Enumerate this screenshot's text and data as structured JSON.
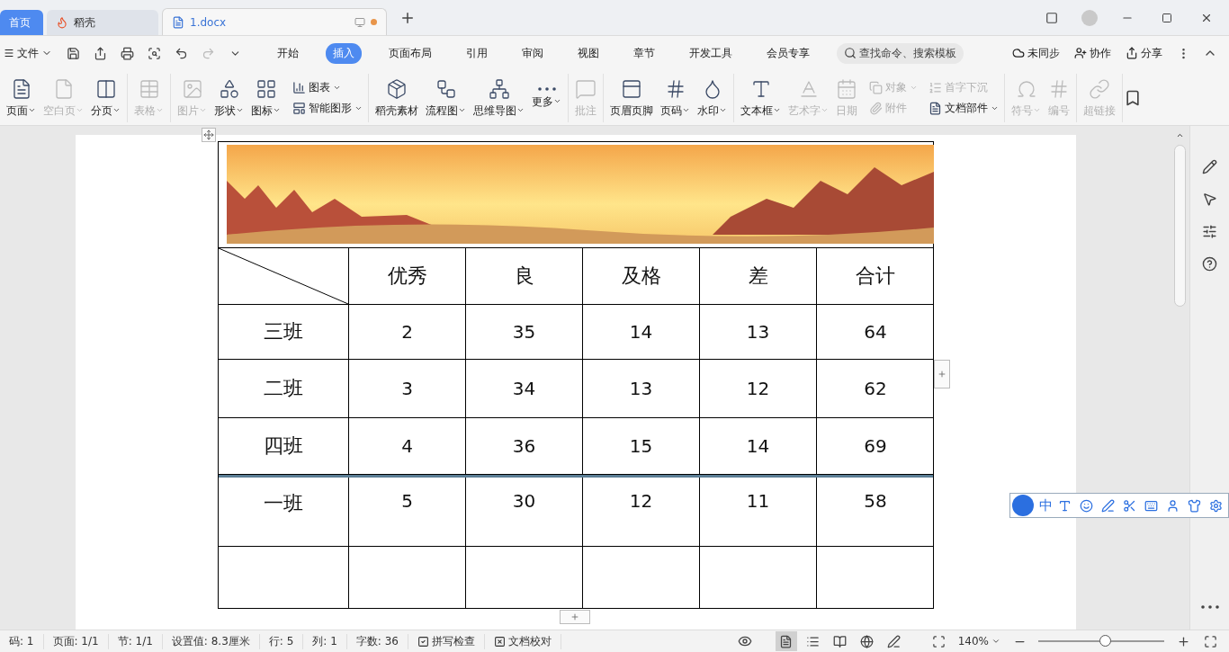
{
  "tabs": [
    {
      "label": "首页",
      "kind": "home",
      "selected": false
    },
    {
      "label": "稻壳",
      "kind": "app",
      "selected": false
    },
    {
      "label": "1.docx",
      "kind": "doc",
      "selected": true
    }
  ],
  "menu": {
    "file": "文件",
    "ribbon_tabs": [
      {
        "label": "开始",
        "selected": false
      },
      {
        "label": "插入",
        "selected": true
      },
      {
        "label": "页面布局",
        "selected": false
      },
      {
        "label": "引用",
        "selected": false
      },
      {
        "label": "审阅",
        "selected": false
      },
      {
        "label": "视图",
        "selected": false
      },
      {
        "label": "章节",
        "selected": false
      },
      {
        "label": "开发工具",
        "selected": false
      },
      {
        "label": "会员专享",
        "selected": false
      }
    ],
    "search": {
      "placeholder": "查找命令、搜索模板"
    },
    "actions": [
      "未同步",
      "协作",
      "分享"
    ]
  },
  "ribbon": [
    [
      {
        "kind": "large",
        "label": "页面",
        "dropdown": true,
        "disabled": false
      },
      {
        "kind": "large",
        "label": "空白页",
        "dropdown": true,
        "disabled": true
      },
      {
        "kind": "large",
        "label": "分页",
        "dropdown": true,
        "disabled": false
      }
    ],
    [
      {
        "kind": "large",
        "label": "表格",
        "dropdown": true,
        "disabled": true
      }
    ],
    [
      {
        "kind": "large",
        "label": "图片",
        "dropdown": true,
        "disabled": true
      },
      {
        "kind": "large",
        "label": "形状",
        "dropdown": true,
        "disabled": false
      },
      {
        "kind": "large",
        "label": "图标",
        "dropdown": true,
        "disabled": false
      },
      {
        "kind": "stack",
        "items": [
          {
            "label": "图表",
            "dropdown": true,
            "disabled": false
          },
          {
            "label": "智能图形",
            "dropdown": true,
            "disabled": false
          }
        ]
      }
    ],
    [
      {
        "kind": "large",
        "label": "稻壳素材",
        "dropdown": false,
        "disabled": false
      },
      {
        "kind": "large",
        "label": "流程图",
        "dropdown": true,
        "disabled": false
      },
      {
        "kind": "large",
        "label": "思维导图",
        "dropdown": true,
        "disabled": false
      },
      {
        "kind": "large",
        "label": "更多",
        "dropdown": true,
        "disabled": false
      }
    ],
    [
      {
        "kind": "large",
        "label": "批注",
        "dropdown": false,
        "disabled": true
      }
    ],
    [
      {
        "kind": "large",
        "label": "页眉页脚",
        "dropdown": false,
        "disabled": false
      },
      {
        "kind": "large",
        "label": "页码",
        "dropdown": true,
        "disabled": false
      },
      {
        "kind": "large",
        "label": "水印",
        "dropdown": true,
        "disabled": false
      }
    ],
    [
      {
        "kind": "large",
        "label": "文本框",
        "dropdown": true,
        "disabled": false
      },
      {
        "kind": "large",
        "label": "艺术字",
        "dropdown": true,
        "disabled": true
      },
      {
        "kind": "large",
        "label": "日期",
        "dropdown": false,
        "disabled": true
      },
      {
        "kind": "stack",
        "items": [
          {
            "label": "对象",
            "dropdown": true,
            "disabled": true
          },
          {
            "label": "附件",
            "dropdown": false,
            "disabled": true
          }
        ]
      },
      {
        "kind": "stack",
        "items": [
          {
            "label": "首字下沉",
            "dropdown": false,
            "disabled": true
          },
          {
            "label": "文档部件",
            "dropdown": true,
            "disabled": false
          }
        ]
      }
    ],
    [
      {
        "kind": "large",
        "label": "符号",
        "dropdown": true,
        "disabled": true
      },
      {
        "kind": "large",
        "label": "编号",
        "dropdown": false,
        "disabled": true
      }
    ],
    [
      {
        "kind": "large",
        "label": "超链接",
        "dropdown": false,
        "disabled": true
      }
    ]
  ],
  "table": {
    "columns": [
      "优秀",
      "良",
      "及格",
      "差",
      "合计"
    ],
    "rows": [
      {
        "label": "三班",
        "values": [
          "2",
          "35",
          "14",
          "13",
          "64"
        ],
        "resize_guide": false
      },
      {
        "label": "二班",
        "values": [
          "3",
          "34",
          "13",
          "12",
          "62"
        ],
        "resize_guide": false
      },
      {
        "label": "四班",
        "values": [
          "4",
          "36",
          "15",
          "14",
          "69"
        ],
        "resize_guide": false
      },
      {
        "label": "一班",
        "values": [
          "5",
          "30",
          "12",
          "11",
          "58"
        ],
        "resize_guide": true
      }
    ]
  },
  "ime": {
    "mode": "中"
  },
  "status_bar": {
    "items": [
      {
        "kind": "text",
        "label": "码: 1"
      },
      {
        "kind": "text",
        "label": "页面: 1/1"
      },
      {
        "kind": "text",
        "label": "节: 1/1"
      },
      {
        "kind": "text",
        "label": "设置值: 8.3厘米"
      },
      {
        "kind": "text",
        "label": "行: 5"
      },
      {
        "kind": "text",
        "label": "列: 1"
      },
      {
        "kind": "text",
        "label": "字数: 36"
      },
      {
        "kind": "check",
        "label": "拼写检查"
      },
      {
        "kind": "cross",
        "label": "文档校对"
      }
    ],
    "views": [
      {
        "selected": true
      },
      {
        "selected": false
      },
      {
        "selected": false
      },
      {
        "selected": false
      },
      {
        "selected": false
      }
    ],
    "zoom": "140%",
    "zoom_level": {
      "level": 0.53
    }
  }
}
